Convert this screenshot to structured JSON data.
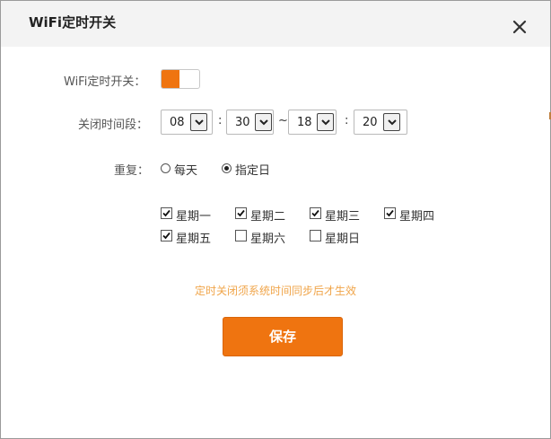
{
  "dialog": {
    "title": "WiFi定时开关",
    "close_icon": "close-icon"
  },
  "form": {
    "toggle_label": "WiFi定时开关：",
    "toggle_on": true,
    "accent_color": "#ef7410",
    "period_label": "关闭时间段：",
    "start_hour": "08",
    "start_minute": "30",
    "range_separator": "~",
    "end_hour": "18",
    "end_minute": "20",
    "time_colon": ":",
    "repeat_label": "重复：",
    "repeat_options": [
      "每天",
      "指定日"
    ],
    "repeat_selected": "指定日",
    "days": [
      {
        "label": "星期一",
        "checked": true
      },
      {
        "label": "星期二",
        "checked": true
      },
      {
        "label": "星期三",
        "checked": true
      },
      {
        "label": "星期四",
        "checked": true
      },
      {
        "label": "星期五",
        "checked": true
      },
      {
        "label": "星期六",
        "checked": false
      },
      {
        "label": "星期日",
        "checked": false
      }
    ],
    "notice": "定时关闭须系统时间同步后才生效",
    "save_label": "保存"
  }
}
